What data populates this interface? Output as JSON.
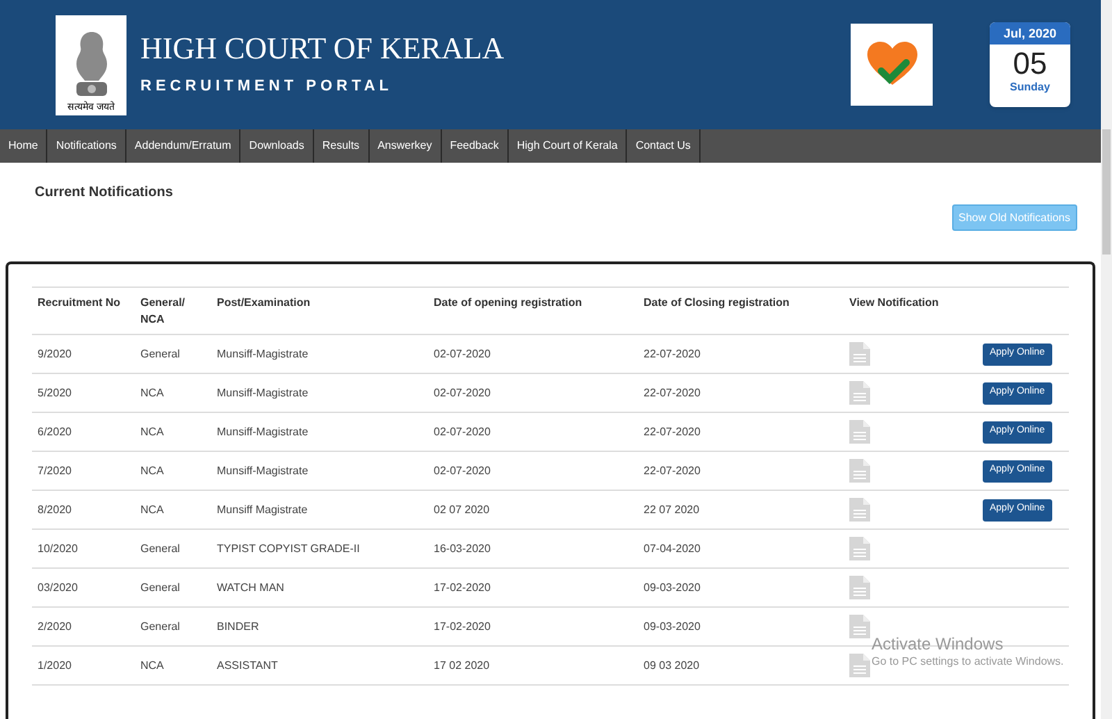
{
  "header": {
    "motto": "सत्यमेव जयते",
    "title": "HIGH COURT OF KERALA",
    "subtitle": "RECRUITMENT PORTAL",
    "calendar": {
      "month": "Jul, 2020",
      "day": "05",
      "weekday": "Sunday"
    }
  },
  "nav": [
    "Home",
    "Notifications",
    "Addendum/Erratum",
    "Downloads",
    "Results",
    "Answerkey",
    "Feedback",
    "High Court of Kerala",
    "Contact Us"
  ],
  "section_title": "Current Notifications",
  "show_old_button": "Show Old Notifications",
  "table": {
    "columns": [
      "Recruitment No",
      "General/ NCA",
      "Post/Examination",
      "Date of opening registration",
      "Date of Closing registration",
      "View Notification"
    ],
    "rows": [
      {
        "no": "9/2020",
        "category": "General",
        "post": "Munsiff-Magistrate",
        "opening": "02-07-2020",
        "closing": "22-07-2020",
        "action": "Apply Online"
      },
      {
        "no": "5/2020",
        "category": "NCA",
        "post": "Munsiff-Magistrate",
        "opening": "02-07-2020",
        "closing": "22-07-2020",
        "action": "Apply Online"
      },
      {
        "no": "6/2020",
        "category": "NCA",
        "post": "Munsiff-Magistrate",
        "opening": "02-07-2020",
        "closing": "22-07-2020",
        "action": "Apply Online"
      },
      {
        "no": "7/2020",
        "category": "NCA",
        "post": "Munsiff-Magistrate",
        "opening": "02-07-2020",
        "closing": "22-07-2020",
        "action": "Apply Online"
      },
      {
        "no": "8/2020",
        "category": "NCA",
        "post": "Munsiff Magistrate",
        "opening": "02 07 2020",
        "closing": "22 07 2020",
        "action": "Apply Online"
      },
      {
        "no": "10/2020",
        "category": "General",
        "post": "TYPIST COPYIST GRADE-II",
        "opening": "16-03-2020",
        "closing": "07-04-2020"
      },
      {
        "no": "03/2020",
        "category": "General",
        "post": "WATCH MAN",
        "opening": "17-02-2020",
        "closing": "09-03-2020"
      },
      {
        "no": "2/2020",
        "category": "General",
        "post": "BINDER",
        "opening": "17-02-2020",
        "closing": "09-03-2020"
      },
      {
        "no": "1/2020",
        "category": "NCA",
        "post": "ASSISTANT",
        "opening": "17 02 2020",
        "closing": "09 03 2020"
      }
    ]
  },
  "os_overlay": {
    "title": "Activate Windows",
    "message": "Go to PC settings to activate Windows."
  }
}
